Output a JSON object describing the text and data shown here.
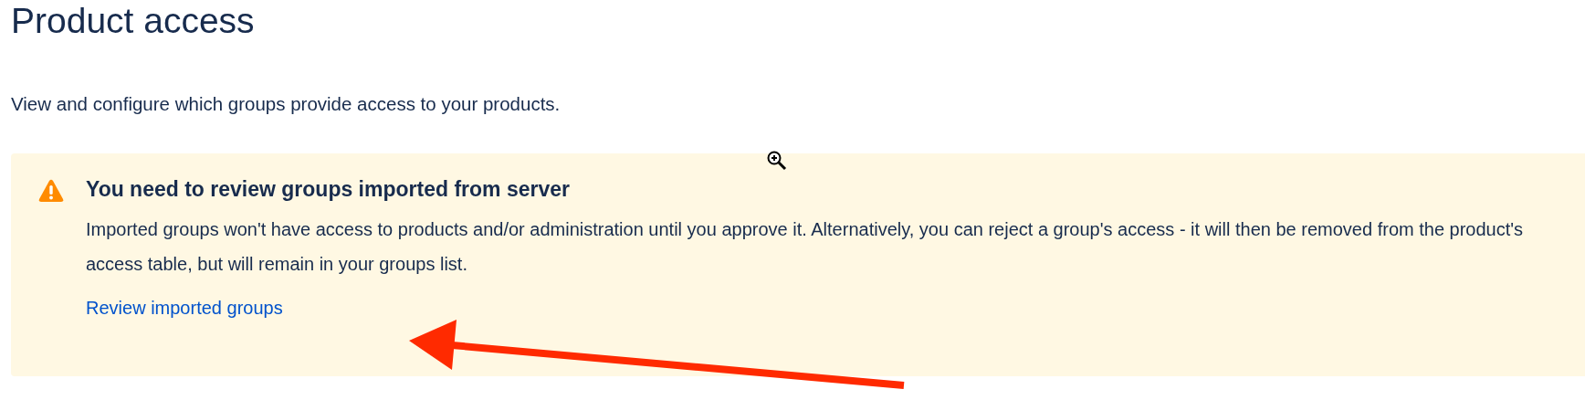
{
  "page": {
    "title": "Product access",
    "description": "View and configure which groups provide access to your products."
  },
  "alert": {
    "kind": "warning",
    "title": "You need to review groups imported from server",
    "body": "Imported groups won't have access to products and/or administration until you approve it. Alternatively, you can reject a group's access - it will then be removed from the product's access table, but will remain in your groups list.",
    "link": "Review imported groups"
  }
}
